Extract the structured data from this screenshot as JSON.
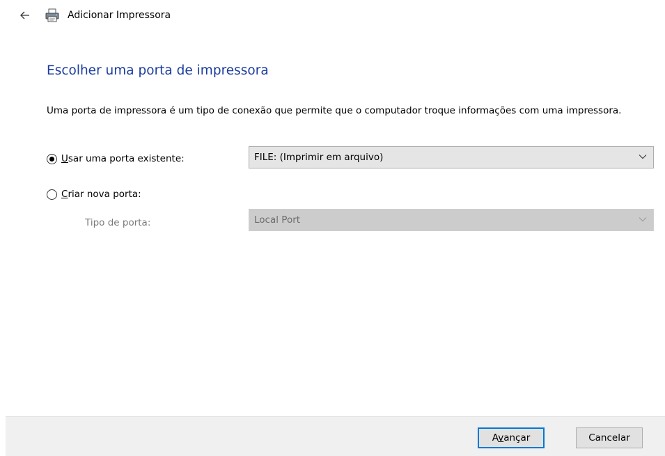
{
  "header": {
    "back_icon": "arrow-left-icon",
    "app_icon": "printer-icon",
    "title": "Adicionar Impressora"
  },
  "main": {
    "heading": "Escolher uma porta de impressora",
    "description": "Uma porta de impressora é um tipo de conexão que permite que o computador troque informações com uma impressora.",
    "existing_port": {
      "access_key": "U",
      "label_rest": "sar uma porta existente:",
      "selected": true,
      "value": "FILE: (Imprimir em arquivo)"
    },
    "new_port": {
      "access_key": "C",
      "label_rest": "riar nova porta:",
      "selected": false,
      "type_label": "Tipo de porta:",
      "type_value": "Local Port",
      "disabled": true
    }
  },
  "footer": {
    "next_before": "A",
    "next_key": "v",
    "next_after": "ançar",
    "cancel_label": "Cancelar"
  },
  "colors": {
    "heading": "#1a3c9e",
    "primary_button_border": "#0078d7"
  }
}
